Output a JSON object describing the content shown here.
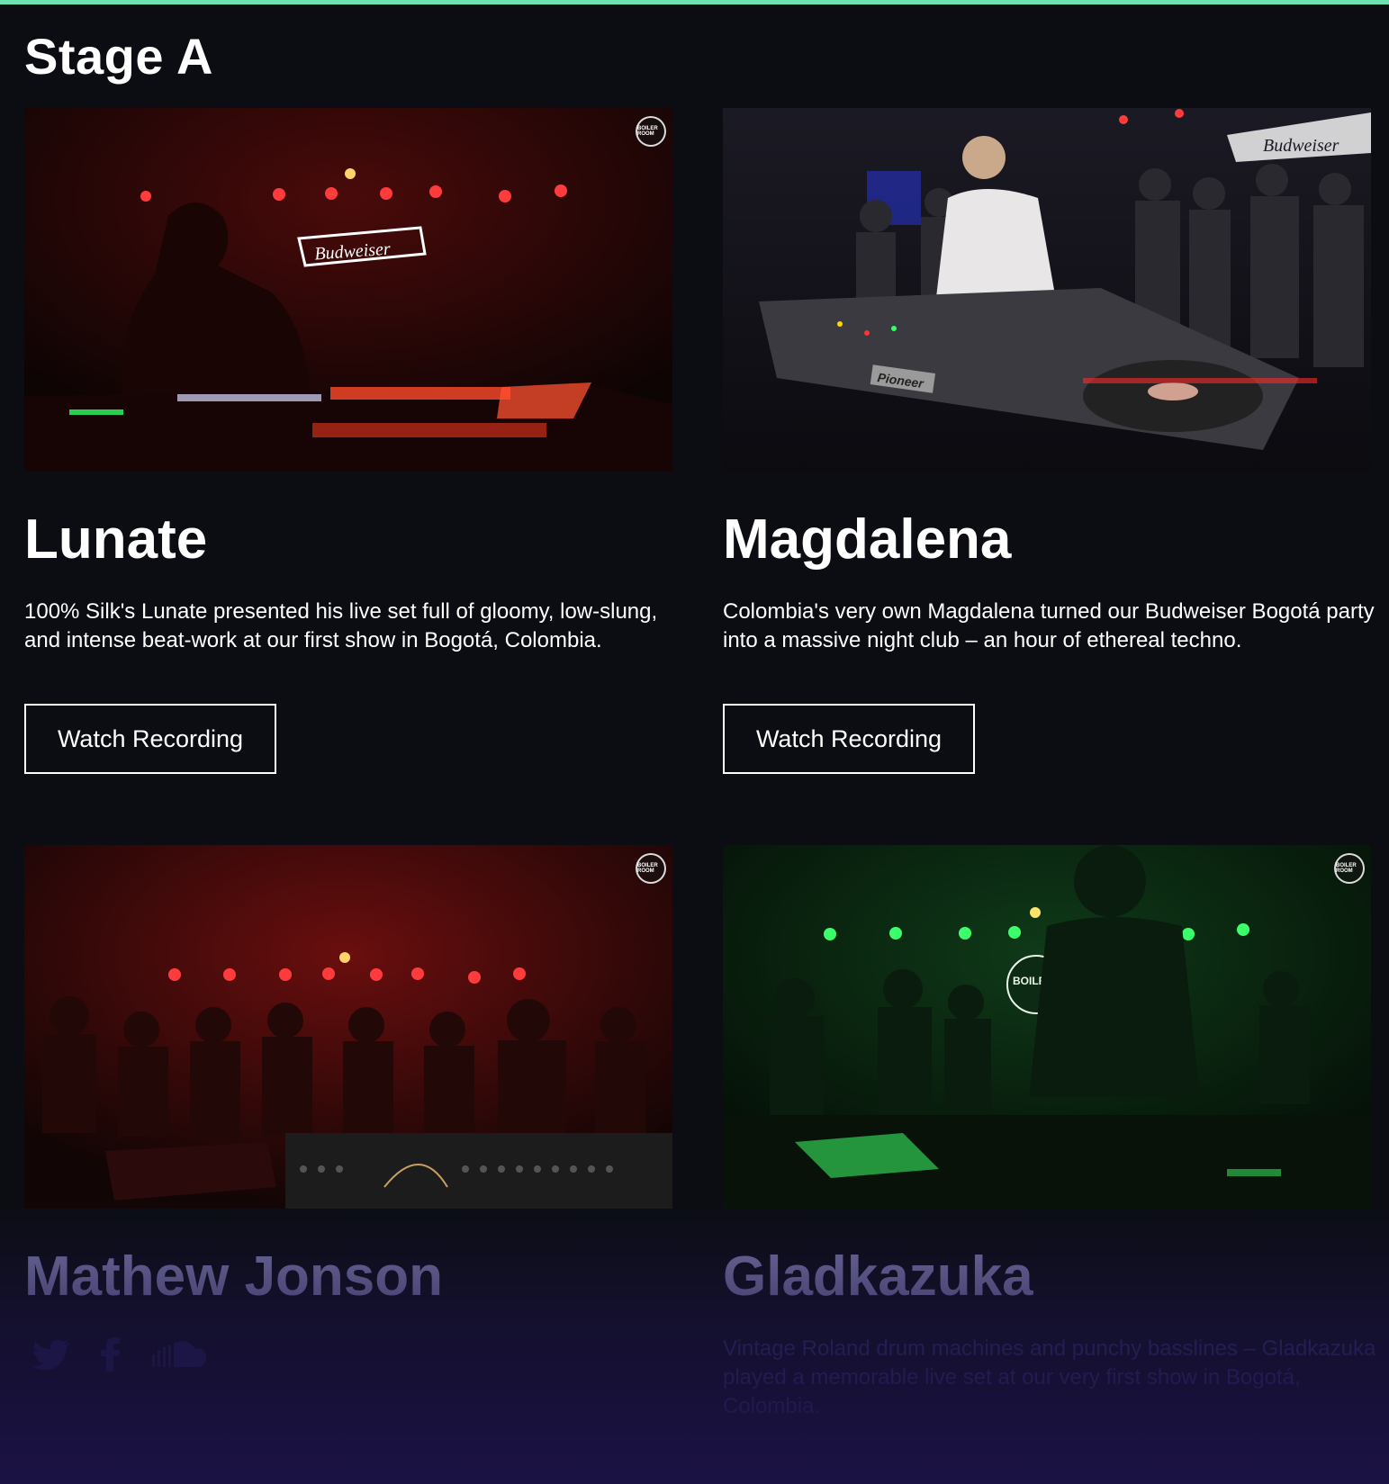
{
  "accent_color": "#6de2b1",
  "stage": {
    "title": "Stage A"
  },
  "cards": [
    {
      "name": "Lunate",
      "description": "100% Silk's Lunate presented his live set full of gloomy, low-slung, and intense beat-work at our first show in Bogotá, Colombia.",
      "button_label": "Watch Recording",
      "image_tone": "red",
      "logo_text": "BOILER ROOM",
      "sign_text": "Budweiser"
    },
    {
      "name": "Magdalena",
      "description": "Colombia's very own Magdalena turned our Budweiser Bogotá party into a massive night club  – an hour of ethereal techno.",
      "button_label": "Watch Recording",
      "image_tone": "dark-crowd",
      "sign_text": "Budweiser",
      "deck_text": "Pioneer"
    },
    {
      "name": "Mathew Jonson",
      "social_icons": [
        "twitter-icon",
        "facebook-icon",
        "soundcloud-icon"
      ],
      "image_tone": "red-crowd",
      "logo_text": "BOILER ROOM"
    },
    {
      "name": "Gladkazuka",
      "description": "Vintage Roland drum machines and punchy basslines – Gladkazuka played a memorable live set at our very first show in Bogotá, Colombia.",
      "image_tone": "green",
      "logo_text": "BOILER ROOM"
    }
  ]
}
